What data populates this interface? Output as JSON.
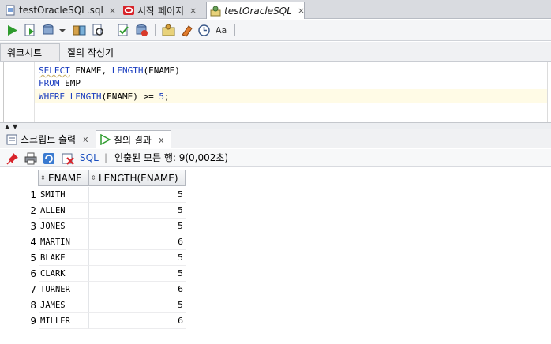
{
  "editor_tabs": [
    {
      "label": "testOracleSQL.sql",
      "icon": "sql-file-icon",
      "close": "×"
    },
    {
      "label": "시작 페이지",
      "icon": "oracle-logo-icon",
      "close": "×"
    },
    {
      "label": "testOracleSQL",
      "icon": "sql-connection-icon",
      "close": "×"
    }
  ],
  "toolbar_icons": [
    "run-statement-icon",
    "run-script-icon",
    "commit-icon",
    "dropdown-icon",
    "explain-plan-icon",
    "autotrace-icon",
    "sql-tuning-icon",
    "rollback-icon",
    "unshared-sql-icon",
    "clear-icon",
    "history-icon",
    "format-icon"
  ],
  "sub_tabs": [
    "워크시트",
    "질의 작성기"
  ],
  "code": {
    "line1": {
      "kw": "SELECT",
      "rest": " ENAME, ",
      "kw2": "LENGTH",
      "rest2": "(ENAME)"
    },
    "line2": {
      "kw": "FROM",
      "rest": " EMP"
    },
    "line3": {
      "kw": "WHERE",
      "mid": " ",
      "kw2": "LENGTH",
      "rest": "(ENAME) >= ",
      "num": "5",
      "end": ";"
    }
  },
  "splitter": {
    "up": "▲",
    "down": "▼"
  },
  "output_tabs": [
    {
      "label": "스크립트 출력",
      "close": "x"
    },
    {
      "label": "질의 결과",
      "close": "x"
    }
  ],
  "result_toolbar": {
    "sql_label": "SQL",
    "separator": "|",
    "status": "인출된 모든 행: 9(0,002초)"
  },
  "grid": {
    "sort_icon": "⇕",
    "columns": [
      "ENAME",
      "LENGTH(ENAME)"
    ],
    "rows": [
      {
        "n": "1",
        "ename": "SMITH",
        "len": "5"
      },
      {
        "n": "2",
        "ename": "ALLEN",
        "len": "5"
      },
      {
        "n": "3",
        "ename": "JONES",
        "len": "5"
      },
      {
        "n": "4",
        "ename": "MARTIN",
        "len": "6"
      },
      {
        "n": "5",
        "ename": "BLAKE",
        "len": "5"
      },
      {
        "n": "6",
        "ename": "CLARK",
        "len": "5"
      },
      {
        "n": "7",
        "ename": "TURNER",
        "len": "6"
      },
      {
        "n": "8",
        "ename": "JAMES",
        "len": "5"
      },
      {
        "n": "9",
        "ename": "MILLER",
        "len": "6"
      }
    ]
  },
  "colors": {
    "keyword": "#1a3dbf",
    "sql_link": "#1a4fbf",
    "highlight_line": "#fffbe6"
  }
}
